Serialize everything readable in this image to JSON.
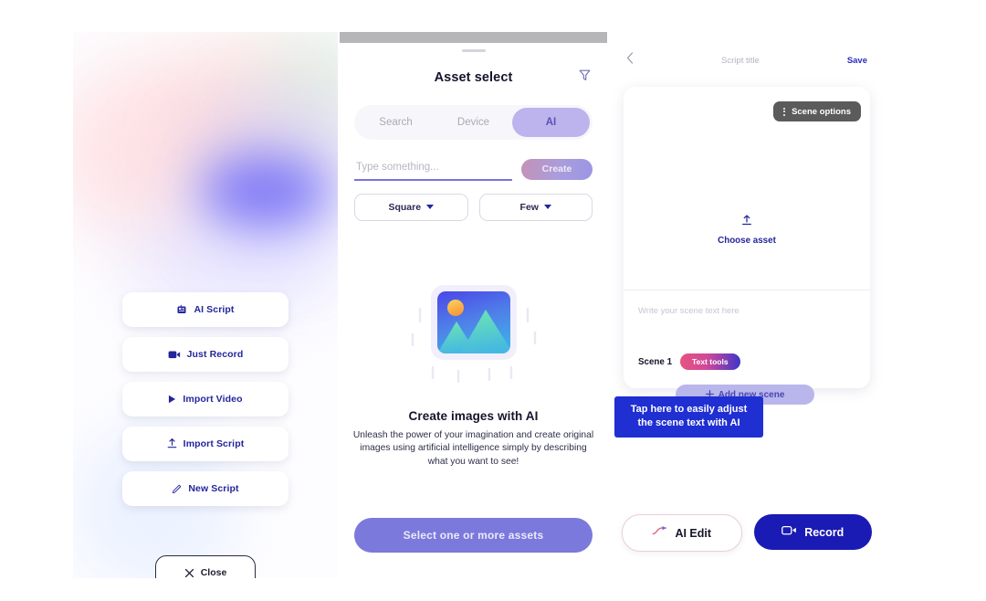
{
  "left_panel": {
    "buttons": [
      {
        "label": "AI Script",
        "icon": "ai-script-icon"
      },
      {
        "label": "Just Record",
        "icon": "video-camera-icon"
      },
      {
        "label": "Import Video",
        "icon": "play-icon"
      },
      {
        "label": "Import Script",
        "icon": "upload-icon"
      },
      {
        "label": "New Script",
        "icon": "pencil-icon"
      }
    ],
    "close_label": "Close",
    "close_icon": "close-x-icon",
    "accent_color": "#23259c"
  },
  "middle_panel": {
    "title": "Asset select",
    "filter_icon": "filter-funnel-icon",
    "tabs": [
      {
        "label": "Search",
        "active": false
      },
      {
        "label": "Device",
        "active": false
      },
      {
        "label": "AI",
        "active": true
      }
    ],
    "prompt_placeholder": "Type something...",
    "prompt_value": "",
    "create_label": "Create",
    "dropdowns": [
      {
        "label": "Square"
      },
      {
        "label": "Few"
      }
    ],
    "illustration_icon": "image-placeholder-icon",
    "heading": "Create images with AI",
    "body": "Unleash the power of your imagination and create original images using artificial intelligence simply by describing what you want to see!",
    "cta_label": "Select one or more assets",
    "cta_color": "#7b79db",
    "active_tab_color": "#bdb4ee"
  },
  "right_panel": {
    "back_icon": "chevron-left-icon",
    "title": "Script title",
    "save_label": "Save",
    "scene_options_label": "Scene options",
    "scene_options_icon": "kebab-menu-icon",
    "choose_asset_label": "Choose asset",
    "choose_asset_icon": "upload-icon",
    "scene_text_placeholder": "Write your scene text here",
    "scene_number": "Scene 1",
    "text_tools_label": "Text tools",
    "add_scene_label": "Add new scene",
    "add_scene_icon": "plus-icon",
    "tooltip_text": "Tap here to easily adjust the scene text with AI",
    "tooltip_color": "#1f2fd2",
    "ai_edit_label": "AI Edit",
    "ai_edit_icon": "ai-wand-icon",
    "record_label": "Record",
    "record_icon": "video-camera-icon",
    "record_color": "#1a1ab4"
  }
}
